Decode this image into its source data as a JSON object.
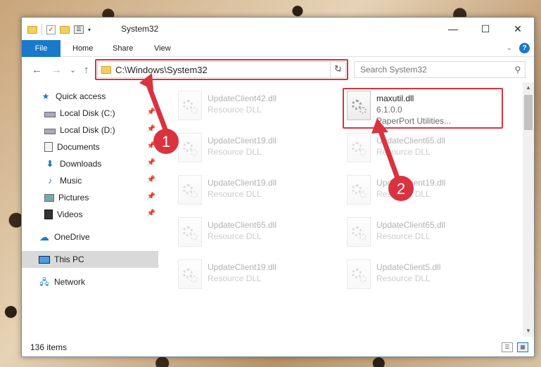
{
  "window": {
    "title": "System32",
    "controls": {
      "minimize": "—",
      "maximize": "☐",
      "close": "✕"
    }
  },
  "quick_access_toolbar": {
    "dropdown": "▾"
  },
  "ribbon": {
    "tabs": [
      "File",
      "Home",
      "Share",
      "View"
    ],
    "collapse": "⌄",
    "help": "?"
  },
  "nav": {
    "back": "←",
    "forward": "→",
    "recent": "⌄",
    "up": "↑",
    "address": "C:\\Windows\\System32",
    "address_dropdown": "⌄",
    "refresh": "↻",
    "search_placeholder": "Search System32",
    "search_icon": "⚲"
  },
  "sidebar": {
    "items": [
      {
        "label": "Quick access",
        "icon": "star-icon",
        "pinned": false
      },
      {
        "label": "Local Disk (C:)",
        "icon": "disk-icon",
        "pinned": true
      },
      {
        "label": "Local Disk (D:)",
        "icon": "disk-icon",
        "pinned": true
      },
      {
        "label": "Documents",
        "icon": "document-icon",
        "pinned": true
      },
      {
        "label": "Downloads",
        "icon": "download-icon",
        "pinned": true
      },
      {
        "label": "Music",
        "icon": "music-icon",
        "pinned": true
      },
      {
        "label": "Pictures",
        "icon": "pictures-icon",
        "pinned": true
      },
      {
        "label": "Videos",
        "icon": "videos-icon",
        "pinned": true
      },
      {
        "label": "OneDrive",
        "icon": "onedrive-icon",
        "pinned": false
      },
      {
        "label": "This PC",
        "icon": "this-pc-icon",
        "pinned": false,
        "selected": true
      },
      {
        "label": "Network",
        "icon": "network-icon",
        "pinned": false
      }
    ],
    "pin_glyph": "📌"
  },
  "files": [
    {
      "name": "UpdateClient42.dll",
      "type": "Resource DLL"
    },
    {
      "name": "maxutil.dll",
      "type": "6.1.0.0",
      "description": "PaperPort Utilities..."
    },
    {
      "name": "UpdateClient19.dll",
      "type": "Resource DLL"
    },
    {
      "name": "UpdateClient65.dll",
      "type": "Resource DLL"
    },
    {
      "name": "UpdateClient19.dll",
      "type": "Resource DLL"
    },
    {
      "name": "UpdateClient19.dll",
      "type": "Resource DLL"
    },
    {
      "name": "UpdateClient65.dll",
      "type": "Resource DLL"
    },
    {
      "name": "UpdateClient65.dll",
      "type": "Resource DLL"
    },
    {
      "name": "UpdateClient19.dll",
      "type": "Resource DLL"
    },
    {
      "name": "UpdateClient5.dll",
      "type": "Resource DLL"
    }
  ],
  "status": {
    "item_count": "136 items"
  },
  "annotations": {
    "step1": "1",
    "step2": "2",
    "color": "#d9333f"
  },
  "colors": {
    "accent": "#1979ca",
    "highlight": "#d9333f",
    "selected_bg": "#d9d9d9"
  }
}
